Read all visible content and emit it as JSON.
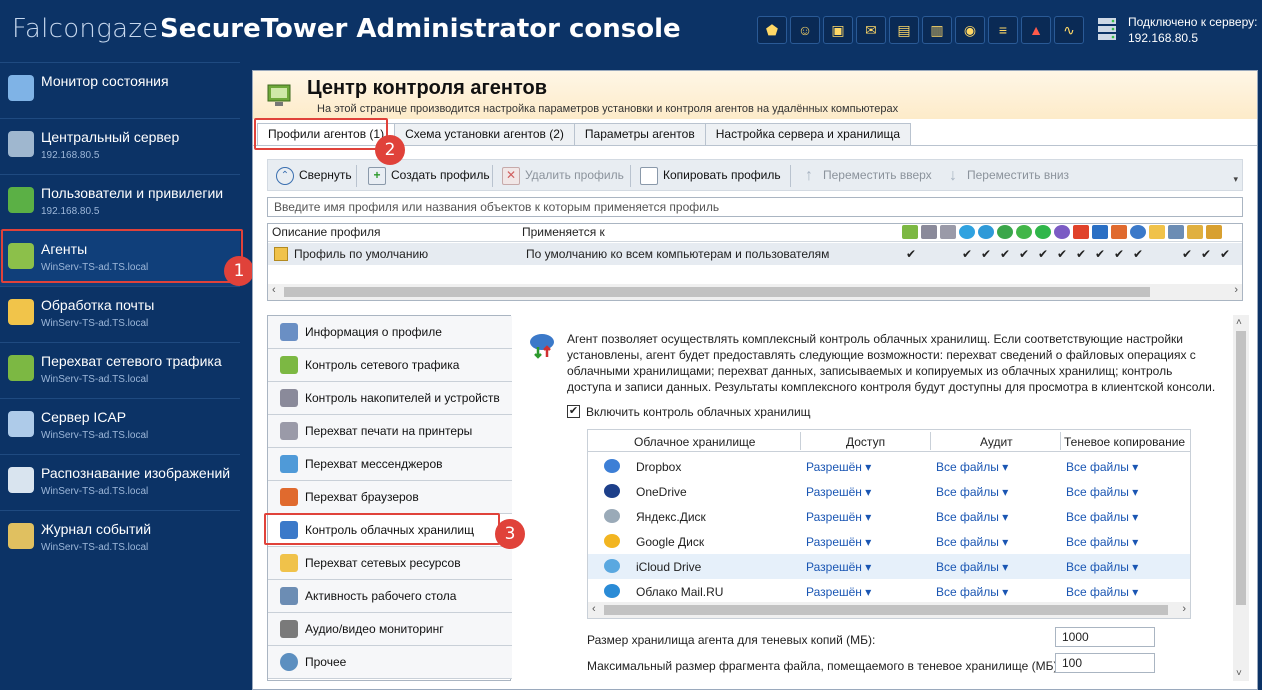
{
  "header": {
    "brand": "Falcongaze",
    "title": "SecureTower Administrator console",
    "toolbar_icons": [
      "shield-icon",
      "users-icon",
      "network-icon",
      "mail-icon",
      "traffic-icon",
      "storage-icon",
      "ocr-icon",
      "report-icon",
      "alarm-icon",
      "chart-icon"
    ],
    "connection": {
      "label": "Подключено к серверу:",
      "ip": "192.168.80.5"
    }
  },
  "sidebar": {
    "items": [
      {
        "label": "Монитор состояния",
        "sub": "",
        "icon": "monitor-icon",
        "color": "#7fb3e6"
      },
      {
        "label": "Центральный сервер",
        "sub": "192.168.80.5",
        "icon": "shield-icon",
        "color": "#9fb7cf"
      },
      {
        "label": "Пользователи и привилегии",
        "sub": "192.168.80.5",
        "icon": "users-icon",
        "color": "#5bb045"
      },
      {
        "label": "Агенты",
        "sub": "WinServ-TS-ad.TS.local",
        "icon": "agent-icon",
        "color": "#8cc04a"
      },
      {
        "label": "Обработка почты",
        "sub": "WinServ-TS-ad.TS.local",
        "icon": "mail-icon",
        "color": "#f1c44a"
      },
      {
        "label": "Перехват сетевого трафика",
        "sub": "WinServ-TS-ad.TS.local",
        "icon": "traffic-icon",
        "color": "#7cb843"
      },
      {
        "label": "Сервер ICAP",
        "sub": "WinServ-TS-ad.TS.local",
        "icon": "icap-icon",
        "color": "#aecbe9"
      },
      {
        "label": "Распознавание изображений",
        "sub": "WinServ-TS-ad.TS.local",
        "icon": "ocr-icon",
        "color": "#d9e4ef"
      },
      {
        "label": "Журнал событий",
        "sub": "WinServ-TS-ad.TS.local",
        "icon": "log-icon",
        "color": "#e0c060"
      }
    ]
  },
  "page": {
    "title": "Центр контроля агентов",
    "subtitle": "На этой странице производится настройка параметров установки и контроля агентов на удалённых компьютерах",
    "tabs": [
      "Профили агентов (1)",
      "Схема установки агентов (2)",
      "Параметры агентов",
      "Настройка сервера и хранилища"
    ]
  },
  "toolbar": {
    "collapse": "Свернуть",
    "create": "Создать профиль",
    "delete": "Удалить профиль",
    "copy": "Копировать профиль",
    "up": "Переместить вверх",
    "down": "Переместить вниз"
  },
  "filter": {
    "placeholder": "Введите имя профиля или названия объектов к которым применяется профиль"
  },
  "profiles_grid": {
    "col_desc": "Описание профиля",
    "col_applies": "Применяется к",
    "row": {
      "desc": "Профиль по умолчанию",
      "applies": "По умолчанию ко всем компьютерам и пользователям"
    },
    "checkmark": "✔"
  },
  "modules": [
    {
      "label": "Информация о профиле",
      "icon": "info-icon",
      "color": "#6a8fc4"
    },
    {
      "label": "Контроль сетевого трафика",
      "icon": "traffic-icon",
      "color": "#7cb843"
    },
    {
      "label": "Контроль накопителей и устройств",
      "icon": "usb-icon",
      "color": "#8a8a9a"
    },
    {
      "label": "Перехват печати на принтеры",
      "icon": "printer-icon",
      "color": "#9a9aa8"
    },
    {
      "label": "Перехват мессенджеров",
      "icon": "messenger-icon",
      "color": "#4f9ad8"
    },
    {
      "label": "Перехват браузеров",
      "icon": "browser-icon",
      "color": "#e06a2e"
    },
    {
      "label": "Контроль облачных хранилищ",
      "icon": "cloud-icon",
      "color": "#3b79c9"
    },
    {
      "label": "Перехват сетевых ресурсов",
      "icon": "folder-icon",
      "color": "#f0c24a"
    },
    {
      "label": "Активность рабочего стола",
      "icon": "desktop-icon",
      "color": "#6c8db4"
    },
    {
      "label": "Аудио/видео мониторинг",
      "icon": "headset-icon",
      "color": "#7a7a7a"
    },
    {
      "label": "Прочее",
      "icon": "gear-icon",
      "color": "#5c8fc0"
    }
  ],
  "cloud": {
    "description": "Агент позволяет осуществлять комплексный контроль облачных хранилищ. Если соответствующие настройки установлены, агент будет предоставлять следующие возможности: перехват сведений о файловых операциях с облачными хранилищами; перехват данных, записываемых и копируемых из облачных хранилищ; контроль доступа и записи данных. Результаты комплексного контроля будут доступны для просмотра в клиентской консоли.",
    "enable_label": "Включить контроль облачных хранилищ",
    "enabled": true,
    "columns": [
      "Облачное хранилище",
      "Доступ",
      "Аудит",
      "Теневое копирование"
    ],
    "rows": [
      {
        "name": "Dropbox",
        "access": "Разрешён",
        "audit": "Все файлы",
        "shadow": "Все файлы",
        "color": "#3d7fd6"
      },
      {
        "name": "OneDrive",
        "access": "Разрешён",
        "audit": "Все файлы",
        "shadow": "Все файлы",
        "color": "#1d3f8a"
      },
      {
        "name": "Яндекс.Диск",
        "access": "Разрешён",
        "audit": "Все файлы",
        "shadow": "Все файлы",
        "color": "#9aaab8"
      },
      {
        "name": "Google Диск",
        "access": "Разрешён",
        "audit": "Все файлы",
        "shadow": "Все файлы",
        "color": "#f2b521"
      },
      {
        "name": "iCloud Drive",
        "access": "Разрешён",
        "audit": "Все файлы",
        "shadow": "Все файлы",
        "color": "#5aa8e0"
      },
      {
        "name": "Облако Mail.RU",
        "access": "Разрешён",
        "audit": "Все файлы",
        "shadow": "Все файлы",
        "color": "#2a8bd6"
      }
    ],
    "shadow_size_label": "Размер хранилища агента для теневых копий (МБ):",
    "shadow_size_value": "1000",
    "fragment_label": "Максимальный размер фрагмента файла, помещаемого в теневое хранилище (МБ):",
    "fragment_value": "100"
  },
  "callouts": {
    "one": "1",
    "two": "2",
    "three": "3"
  }
}
